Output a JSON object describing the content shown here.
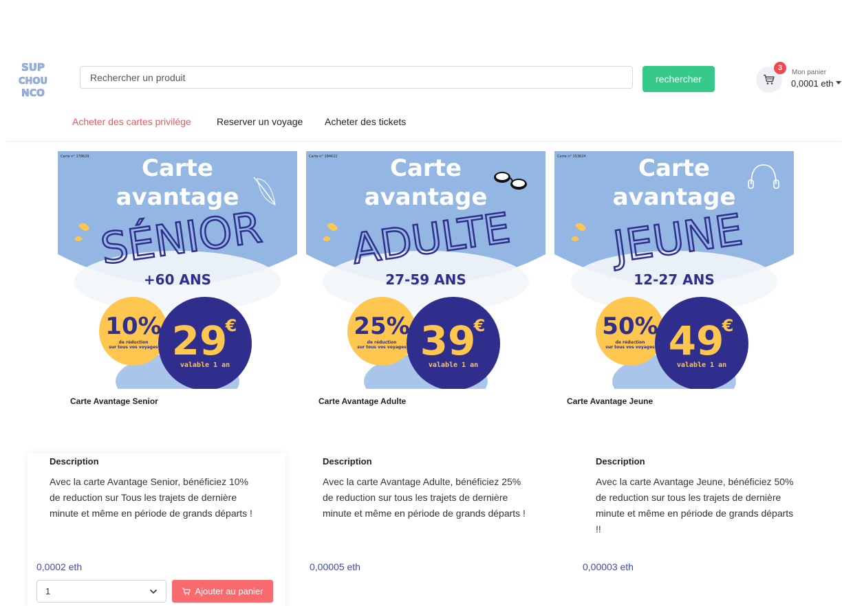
{
  "header": {
    "logo_text": [
      "SUP",
      "CHOU",
      "NCO"
    ],
    "search_placeholder": "Rechercher un produit",
    "search_button": "rechercher",
    "cart": {
      "count": "3",
      "caption": "Mon panier",
      "amount": "0,0001 eth"
    }
  },
  "nav": [
    {
      "label": "Acheter des cartes privilége",
      "active": true
    },
    {
      "label": "Reserver un voyage",
      "active": false
    },
    {
      "label": "Acheter des tickets",
      "active": false
    }
  ],
  "colors": {
    "accent_red": "#f0565a",
    "green": "#37c98a",
    "card_blue": "#93b7e2",
    "navy": "#2f2e8c",
    "yellow": "#ffc74f"
  },
  "products": [
    {
      "card_number": "Carte n° 178629",
      "heading_1": "Carte",
      "heading_2": "avantage",
      "category": "SÉNIOR",
      "age": "+60 ANS",
      "discount": "10%",
      "discount_caption_1": "de réduction",
      "discount_caption_2": "sur tous vos voyages",
      "card_price": "29",
      "currency": "€",
      "validity": "valable 1 an",
      "decor_icon": "feather-icon",
      "title": "Carte Avantage Senior",
      "description_heading": "Description",
      "description": "Avec la carte Avantage Senior, bénéficiez 10% de reduction sur Tous les trajets de dernière minute et même en période de grands départs !",
      "price": "0,0002 eth"
    },
    {
      "card_number": "Carte n° 184622",
      "heading_1": "Carte",
      "heading_2": "avantage",
      "category": "ADULTE",
      "age": "27-59 ANS",
      "discount": "25%",
      "discount_caption_1": "de réduction",
      "discount_caption_2": "sur tous vos voyages",
      "card_price": "39",
      "currency": "€",
      "validity": "valable 1 an",
      "decor_icon": "glasses-icon",
      "title": "Carte Avantage Adulte",
      "description_heading": "Description",
      "description": "Avec la carte Avantage Adulte, bénéficiez 25% de reduction sur tous les trajets de dernière minute et même en période de grands départs !",
      "price": "0,00005 eth"
    },
    {
      "card_number": "Carte n° 153624",
      "heading_1": "Carte",
      "heading_2": "avantage",
      "category": "JEUNE",
      "age": "12-27 ANS",
      "discount": "50%",
      "discount_caption_1": "de réduction",
      "discount_caption_2": "sur tous vos voyages",
      "card_price": "49",
      "currency": "€",
      "validity": "valable 1 an",
      "decor_icon": "headphones-icon",
      "title": "Carte Avantage Jeune",
      "description_heading": "Description",
      "description": "Avec la carte Avantage Jeune, bénéficiez 50% de reduction sur tous les trajets de dernière minute et même en période de grands départs !!",
      "price": "0,00003 eth"
    }
  ],
  "purchase": {
    "quantity": "1",
    "add_button": "Ajouter au panier"
  }
}
